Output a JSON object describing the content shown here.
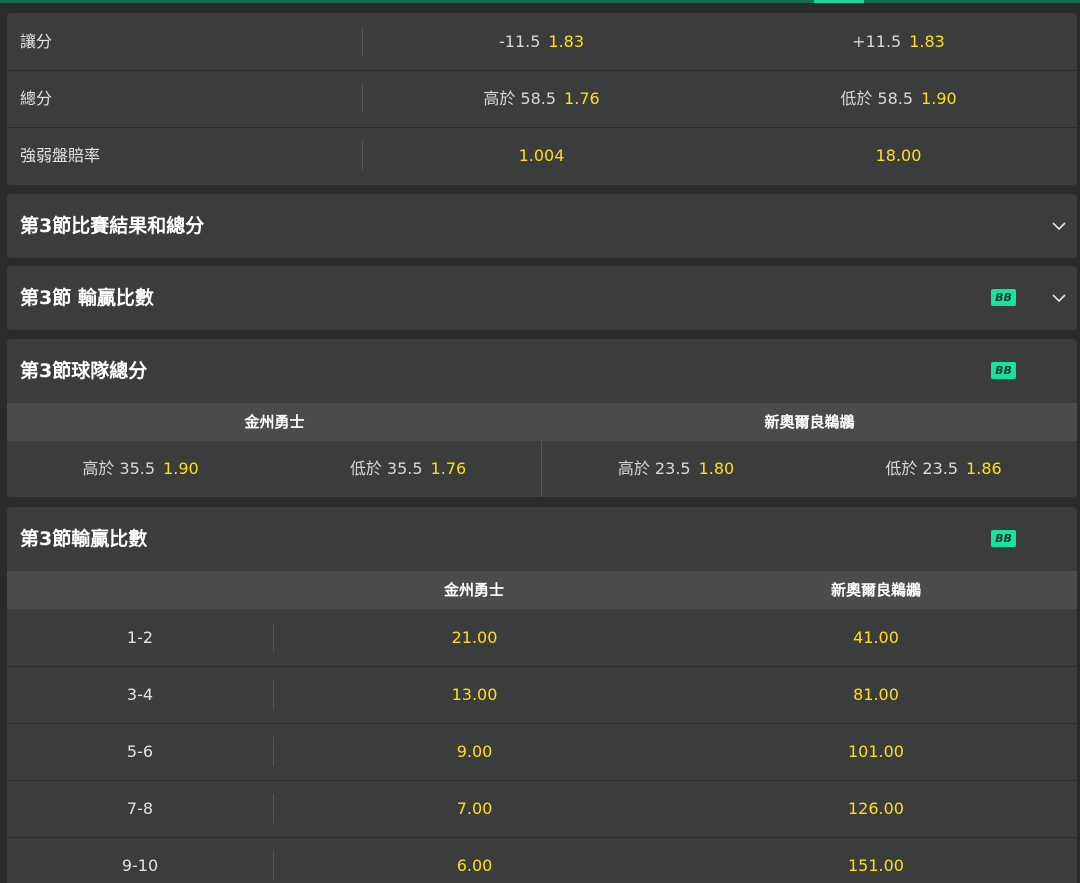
{
  "colors": {
    "accent": "#1ed995",
    "odds": "#ffdf1b",
    "badge": "#14e3a1",
    "panel": "#3b3d3c"
  },
  "top_markets": [
    {
      "label": "讓分",
      "left": {
        "pre": "-11.5",
        "odds": "1.83"
      },
      "right": {
        "pre": "+11.5",
        "odds": "1.83"
      }
    },
    {
      "label": "總分",
      "left": {
        "pre": "高於 58.5",
        "odds": "1.76"
      },
      "right": {
        "pre": "低於 58.5",
        "odds": "1.90"
      }
    },
    {
      "label": "強弱盤賠率",
      "left": {
        "pre": "",
        "odds": "1.004"
      },
      "right": {
        "pre": "",
        "odds": "18.00"
      }
    }
  ],
  "section_q3_result_total": {
    "title": "第3節比賽結果和總分",
    "icon": "chevron-down-icon"
  },
  "section_q3_winning_margin_collapsed": {
    "title": "第3節 輸贏比數",
    "badge": "BB",
    "icon": "chevron-down-icon"
  },
  "section_q3_team_total": {
    "title": "第3節球隊總分",
    "badge": "BB",
    "teams": [
      "金州勇士",
      "新奧爾良鵜鶘"
    ],
    "selections": [
      {
        "pre": "高於 35.5",
        "odds": "1.90"
      },
      {
        "pre": "低於 35.5",
        "odds": "1.76"
      },
      {
        "pre": "高於 23.5",
        "odds": "1.80"
      },
      {
        "pre": "低於 23.5",
        "odds": "1.86"
      }
    ]
  },
  "section_q3_winning_margin": {
    "title": "第3節輸贏比數",
    "badge": "BB",
    "teams": [
      "金州勇士",
      "新奧爾良鵜鶘"
    ],
    "rows": [
      {
        "margin": "1-2",
        "home": "21.00",
        "away": "41.00"
      },
      {
        "margin": "3-4",
        "home": "13.00",
        "away": "81.00"
      },
      {
        "margin": "5-6",
        "home": "9.00",
        "away": "101.00"
      },
      {
        "margin": "7-8",
        "home": "7.00",
        "away": "126.00"
      },
      {
        "margin": "9-10",
        "home": "6.00",
        "away": "151.00"
      }
    ]
  }
}
